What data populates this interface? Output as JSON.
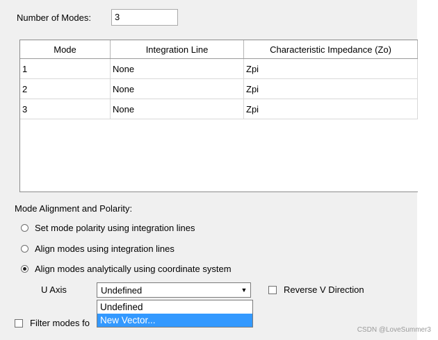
{
  "number_of_modes": {
    "label": "Number of Modes:",
    "value": "3"
  },
  "table": {
    "columns": [
      "Mode",
      "Integration Line",
      "Characteristic Impedance (Zo)"
    ],
    "rows": [
      [
        "1",
        "None",
        "Zpi"
      ],
      [
        "2",
        "None",
        "Zpi"
      ],
      [
        "3",
        "None",
        "Zpi"
      ]
    ]
  },
  "alignment": {
    "title": "Mode Alignment and Polarity:",
    "options": [
      {
        "label": "Set mode polarity using integration lines",
        "selected": false
      },
      {
        "label": "Align modes using integration lines",
        "selected": false
      },
      {
        "label": "Align modes analytically using coordinate system",
        "selected": true
      }
    ],
    "u_axis": {
      "label": "U Axis",
      "value": "Undefined",
      "options": [
        "Undefined",
        "New Vector..."
      ],
      "highlighted": "New Vector..."
    },
    "reverse_v": {
      "label": "Reverse V Direction",
      "checked": false
    }
  },
  "filter": {
    "label": "Filter modes fo",
    "checked": false
  },
  "watermark": "CSDN @LoveSummer3",
  "colors": {
    "panel": "#f0f0f0",
    "highlight": "#3399ff"
  }
}
